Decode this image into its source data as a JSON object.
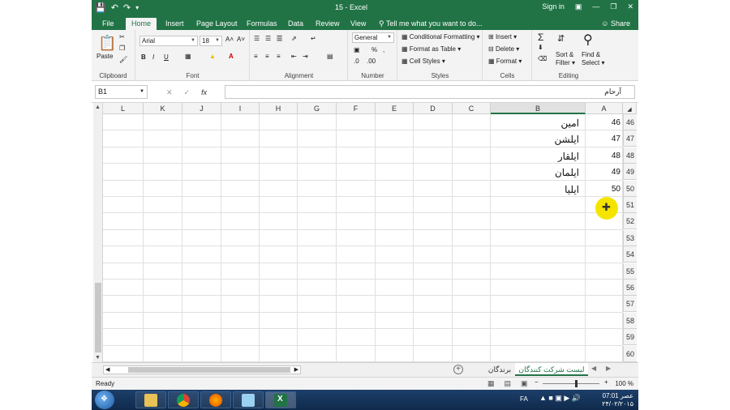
{
  "titlebar": {
    "title": "15 - Excel",
    "signin": "Sign in",
    "share": "Share"
  },
  "tabs": [
    {
      "label": "File"
    },
    {
      "label": "Home"
    },
    {
      "label": "Insert"
    },
    {
      "label": "Page Layout"
    },
    {
      "label": "Formulas"
    },
    {
      "label": "Data"
    },
    {
      "label": "Review"
    },
    {
      "label": "View"
    }
  ],
  "tellme": "Tell me what you want to do...",
  "ribbon": {
    "clipboard": {
      "label": "Clipboard",
      "paste": "Paste"
    },
    "font": {
      "label": "Font",
      "name": "Arial",
      "size": "18"
    },
    "alignment": {
      "label": "Alignment"
    },
    "number": {
      "label": "Number",
      "format": "General"
    },
    "styles": {
      "label": "Styles",
      "conditional": "Conditional Formatting",
      "format_table": "Format as Table",
      "cell_styles": "Cell Styles"
    },
    "cells": {
      "label": "Cells",
      "insert": "Insert",
      "delete": "Delete",
      "format": "Format"
    },
    "editing": {
      "label": "Editing",
      "sort": "Sort &",
      "filter": "Filter",
      "find": "Find &",
      "select": "Select"
    }
  },
  "formula_bar": {
    "name_box": "B1",
    "content": "آرحام"
  },
  "columns": [
    "L",
    "K",
    "J",
    "I",
    "H",
    "G",
    "F",
    "E",
    "D",
    "C",
    "B",
    "A"
  ],
  "rows": [
    {
      "num": "46",
      "a": "46",
      "b": "امین"
    },
    {
      "num": "47",
      "a": "47",
      "b": "ایلشن"
    },
    {
      "num": "48",
      "a": "48",
      "b": "ایلقار"
    },
    {
      "num": "49",
      "a": "49",
      "b": "ایلمان"
    },
    {
      "num": "50",
      "a": "50",
      "b": "ایلیا"
    },
    {
      "num": "51",
      "a": "",
      "b": ""
    },
    {
      "num": "52",
      "a": "",
      "b": ""
    },
    {
      "num": "53",
      "a": "",
      "b": ""
    },
    {
      "num": "54",
      "a": "",
      "b": ""
    },
    {
      "num": "55",
      "a": "",
      "b": ""
    },
    {
      "num": "56",
      "a": "",
      "b": ""
    },
    {
      "num": "57",
      "a": "",
      "b": ""
    },
    {
      "num": "58",
      "a": "",
      "b": ""
    },
    {
      "num": "59",
      "a": "",
      "b": ""
    },
    {
      "num": "60",
      "a": "",
      "b": ""
    }
  ],
  "sheets": [
    {
      "label": "لیست شرکت کنندگان",
      "active": true
    },
    {
      "label": "برندگان",
      "active": false
    }
  ],
  "status": {
    "ready": "Ready",
    "zoom": "100 %"
  },
  "taskbar": {
    "lang": "FA",
    "time": "عصر 07:01",
    "date": "۲۴/۰۲/۲۰۱۵"
  },
  "colors": {
    "accent": "#217346",
    "cursor": "#f5e400"
  }
}
